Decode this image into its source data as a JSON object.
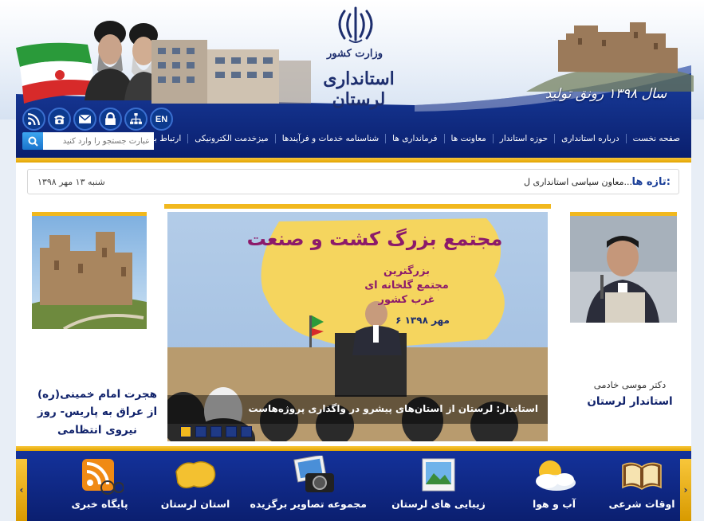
{
  "header": {
    "ministry": "وزارت کشور",
    "province": "استانداری لرستان",
    "slogan": "سال ۱۳۹۸ رونق تولید"
  },
  "icons": [
    "rss-icon",
    "phone-icon",
    "mail-icon",
    "lock-icon",
    "sitemap-icon"
  ],
  "lang_button": "EN",
  "search": {
    "placeholder": "عبارت جستجو را وارد کنید"
  },
  "nav": {
    "items": [
      "صفحه نخست",
      "درباره استانداری",
      "حوزه استاندار",
      "معاونت ها",
      "فرمانداری ها",
      "شناسنامه خدمات و فرآیندها",
      "میزخدمت الکترونیکی",
      "ارتباط با ما"
    ]
  },
  "ticker": {
    "label": "تازه ها:",
    "text": "معاون سیاسی استانداری ل...",
    "date": "شنبه ۱۳ مهر ۱۳۹۸"
  },
  "left_card": {
    "title": "هجرت امام خمینی(ره) از عراق به پاریس- روز نیروی انتظامی"
  },
  "slider": {
    "caption": "استاندار: لرستان از استان‌های پیشرو در واگذاری پروژه‌هاست",
    "banner_title": "مجتمع بزرگ کشت و صنعت",
    "banner_sub1": "بزرگترین",
    "banner_sub2": "مجتمع گلخانه ای",
    "banner_sub3": "غرب کشور",
    "banner_date": "۶ مهر ۱۳۹۸",
    "dots": 5,
    "active_dot": 1
  },
  "governor": {
    "name": "دکتر موسی خادمی",
    "title": "استاندار لرستان"
  },
  "bottom": {
    "items": [
      "پایگاه خبری",
      "استان لرستان",
      "مجموعه تصاویر برگزیده",
      "زیبایی های لرستان",
      "آب و هوا",
      "اوقات شرعی"
    ]
  },
  "colors": {
    "navy": "#0c2a7c",
    "gold": "#f1b81e",
    "link": "#10226b"
  }
}
